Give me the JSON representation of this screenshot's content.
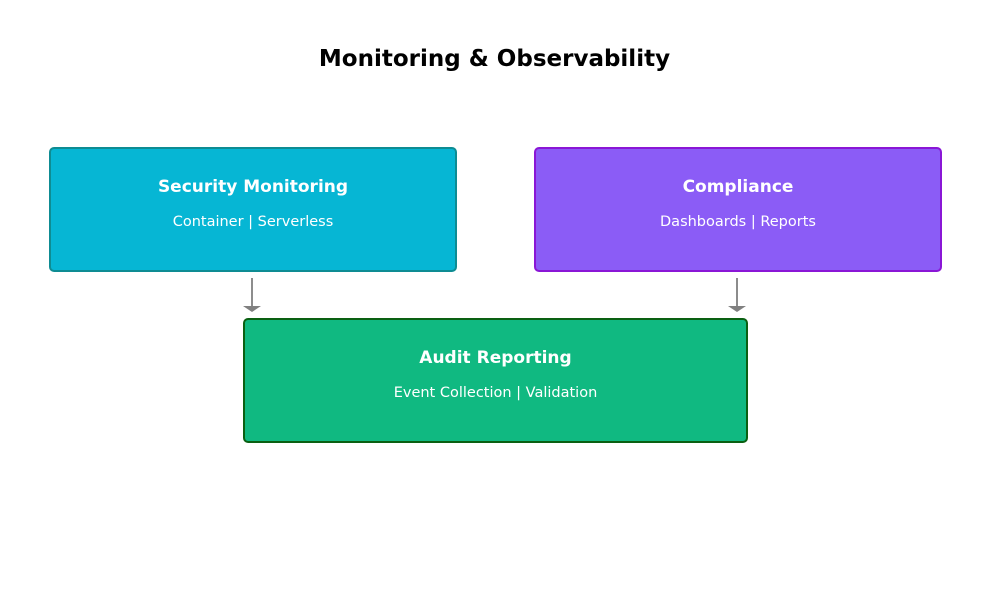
{
  "diagram": {
    "title": "Monitoring & Observability",
    "nodes": {
      "security": {
        "title": "Security Monitoring",
        "subtitle": "Container | Serverless",
        "fill": "#06b6d4",
        "border": "#0e8c93"
      },
      "compliance": {
        "title": "Compliance",
        "subtitle": "Dashboards | Reports",
        "fill": "#8b5cf6",
        "border": "#8a16d6"
      },
      "audit": {
        "title": "Audit Reporting",
        "subtitle": "Event Collection | Validation",
        "fill": "#10b981",
        "border": "#0a6012"
      }
    },
    "edges": [
      {
        "from": "security",
        "to": "audit"
      },
      {
        "from": "compliance",
        "to": "audit"
      }
    ],
    "arrow_color": "#808080"
  }
}
